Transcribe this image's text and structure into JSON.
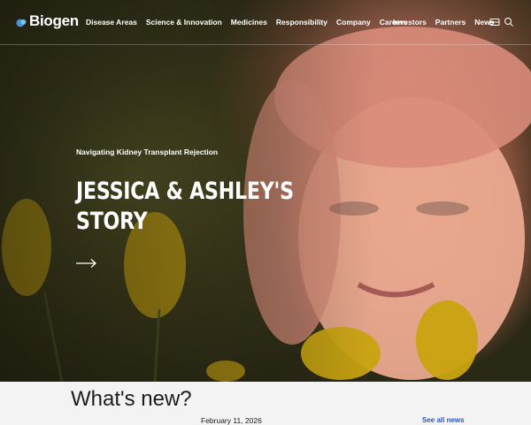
{
  "brand": {
    "name": "Biogen"
  },
  "nav": {
    "primary": [
      "Disease Areas",
      "Science & Innovation",
      "Medicines",
      "Responsibility",
      "Company",
      "Careers"
    ],
    "secondary": [
      "Investors",
      "Partners",
      "News"
    ],
    "icons": [
      "globe-icon",
      "search-icon"
    ]
  },
  "hero": {
    "eyebrow": "Navigating Kidney Transplant Rejection",
    "title": "JESSICA & ASHLEY'S STORY",
    "cta_icon": "arrow-right-icon"
  },
  "news": {
    "heading": "What's new?",
    "first_date": "February 11, 2026",
    "see_all_label": "See all news"
  },
  "colors": {
    "hero_text": "#ffffff",
    "link_blue": "#2a56c6",
    "page_bg": "#f3f3f3"
  }
}
